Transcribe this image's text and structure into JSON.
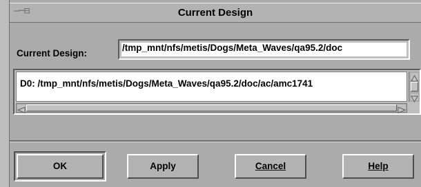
{
  "window": {
    "title": "Current Design",
    "menu_glyph": "‒─⊟"
  },
  "form": {
    "current_design_label": "Current Design:",
    "current_design_value": "/tmp_mnt/nfs/metis/Dogs/Meta_Waves/qa95.2/doc"
  },
  "design_list": {
    "items": [
      "D0: /tmp_mnt/nfs/metis/Dogs/Meta_Waves/qa95.2/doc/ac/amc1741"
    ]
  },
  "buttons": {
    "ok": "OK",
    "apply": "Apply",
    "cancel": "Cancel",
    "help": "Help"
  },
  "colors": {
    "window_bg": "#ababab",
    "field_bg": "#ffffff"
  },
  "icons": {
    "window_menu": "window-menu-icon",
    "scroll_up": "triangle-up-icon",
    "scroll_down": "triangle-down-icon",
    "scroll_left": "triangle-left-icon",
    "scroll_right": "triangle-right-icon"
  }
}
